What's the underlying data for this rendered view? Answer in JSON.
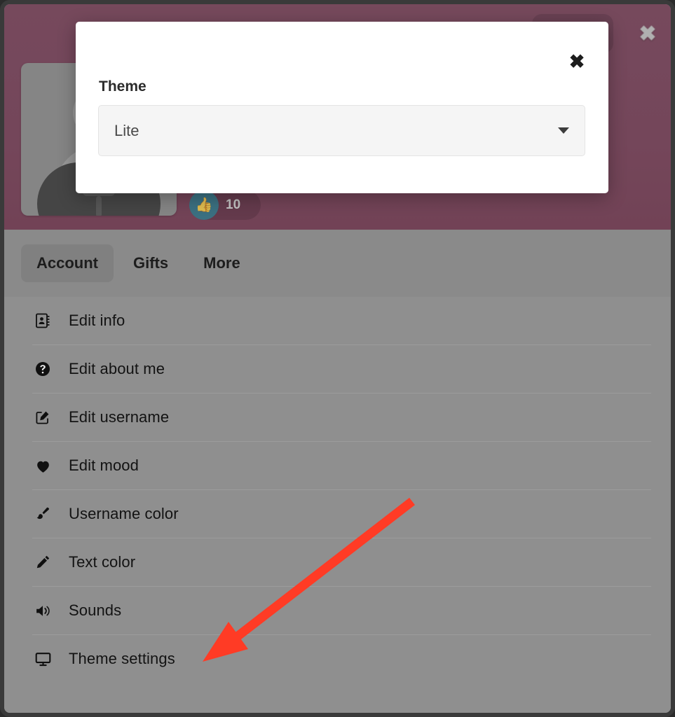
{
  "window": {
    "header_close_icon": "close-icon",
    "header_close_glyph": "✖"
  },
  "profile": {
    "avatar_icon": "avatar-placeholder-icon",
    "avatar_overlay_icon": "camera-icon",
    "like_badge": {
      "icon": "thumbs-up-icon",
      "glyph": "👍",
      "count": "10"
    }
  },
  "tabs": [
    {
      "label": "Account",
      "selected": true
    },
    {
      "label": "Gifts",
      "selected": false
    },
    {
      "label": "More",
      "selected": false
    }
  ],
  "settings_list": [
    {
      "label": "Edit info",
      "icon": "address-book-icon"
    },
    {
      "label": "Edit about me",
      "icon": "question-circle-icon"
    },
    {
      "label": "Edit username",
      "icon": "pencil-square-icon"
    },
    {
      "label": "Edit mood",
      "icon": "heart-icon"
    },
    {
      "label": "Username color",
      "icon": "paint-brush-icon"
    },
    {
      "label": "Text color",
      "icon": "pencil-icon"
    },
    {
      "label": "Sounds",
      "icon": "volume-icon"
    },
    {
      "label": "Theme settings",
      "icon": "monitor-icon"
    }
  ],
  "modal": {
    "close_icon": "close-icon",
    "close_glyph": "✖",
    "label": "Theme",
    "select": {
      "value": "Lite",
      "caret_icon": "chevron-down-icon"
    }
  },
  "annotation": {
    "arrow_color": "#ff3b25",
    "points_to": "Theme settings"
  },
  "colors": {
    "header_maroon": "#8b4764",
    "panel_grey": "#9a9a9a",
    "tab_selected_grey": "#8a8a8a",
    "like_teal": "#2e7d96",
    "modal_white": "#ffffff",
    "select_grey": "#f5f5f5",
    "annotation_red": "#ff3b25"
  }
}
